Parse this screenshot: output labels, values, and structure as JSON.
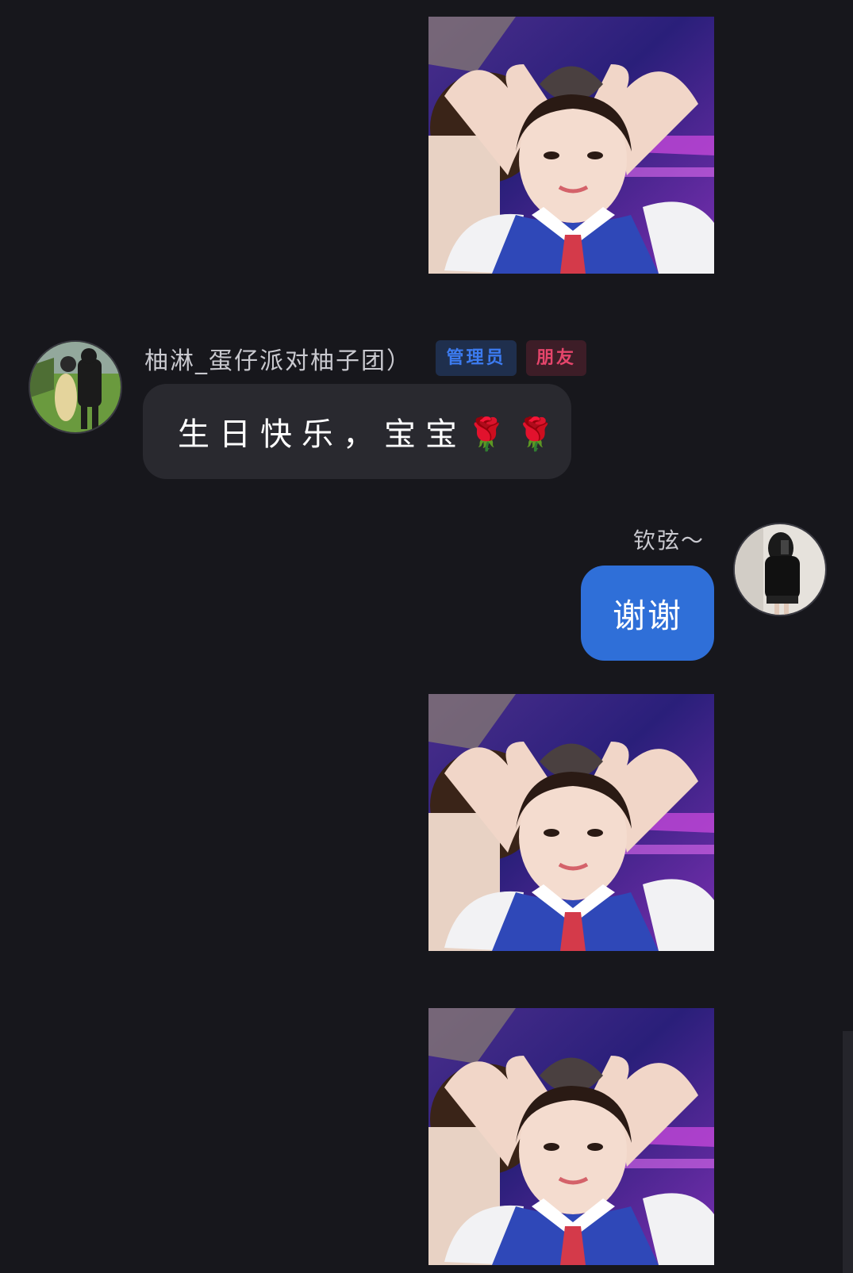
{
  "colors": {
    "background": "#17171c",
    "incoming_bubble": "#29292f",
    "outgoing_bubble": "#2f6fd8",
    "admin_badge_text": "#3c7bf0",
    "friend_badge_text": "#e5456b"
  },
  "messages": [
    {
      "type": "image",
      "direction": "outgoing",
      "image_desc": "sticker-heart-hands-photo"
    },
    {
      "type": "text",
      "direction": "incoming",
      "sender": "柚淋_蛋仔派对柚子团）",
      "badges": [
        "管理员",
        "朋友"
      ],
      "text": "生日快乐，宝宝🌹🌹"
    },
    {
      "type": "text",
      "direction": "outgoing",
      "sender": "钦弦～",
      "text": "谢谢"
    },
    {
      "type": "image",
      "direction": "outgoing",
      "image_desc": "sticker-heart-hands-photo"
    },
    {
      "type": "image",
      "direction": "outgoing",
      "image_desc": "sticker-heart-hands-photo"
    }
  ]
}
